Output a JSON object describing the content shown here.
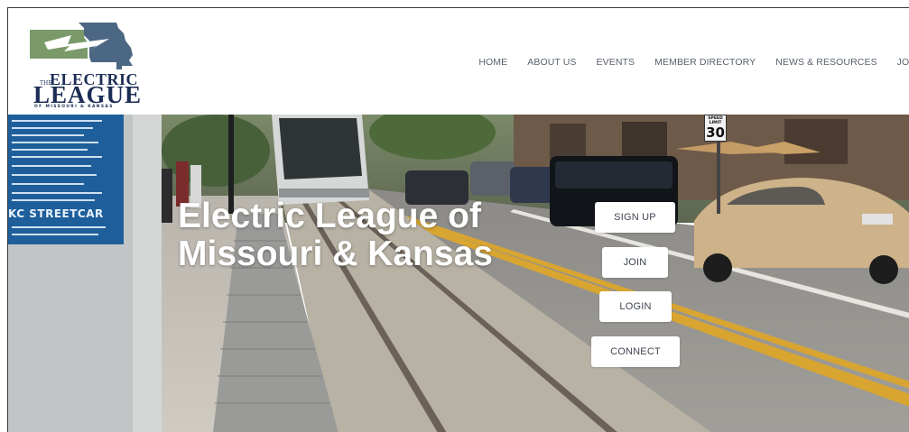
{
  "logo": {
    "the": "THE",
    "electric": "ELECTRIC",
    "league": "LEAGUE",
    "subtitle": "OF MISSOURI & KANSAS"
  },
  "nav": {
    "items": [
      {
        "label": "HOME"
      },
      {
        "label": "ABOUT US"
      },
      {
        "label": "EVENTS"
      },
      {
        "label": "MEMBER DIRECTORY"
      },
      {
        "label": "NEWS & RESOURCES"
      },
      {
        "label": "JOIN"
      }
    ]
  },
  "hero": {
    "title_line1": "Electric League of",
    "title_line2": "Missouri & Kansas",
    "buttons": {
      "signup": "SIGN UP",
      "join": "JOIN",
      "login": "LOGIN",
      "connect": "CONNECT"
    },
    "sign_text": "KC STREETCAR",
    "speed_limit": {
      "label": "SPEED LIMIT",
      "value": "30"
    }
  },
  "colors": {
    "brand_navy": "#1b2d55",
    "brand_green": "#7a9a6a",
    "brand_slate": "#4c6783",
    "nav_text": "#5a6270",
    "button_bg": "#ffffff"
  }
}
